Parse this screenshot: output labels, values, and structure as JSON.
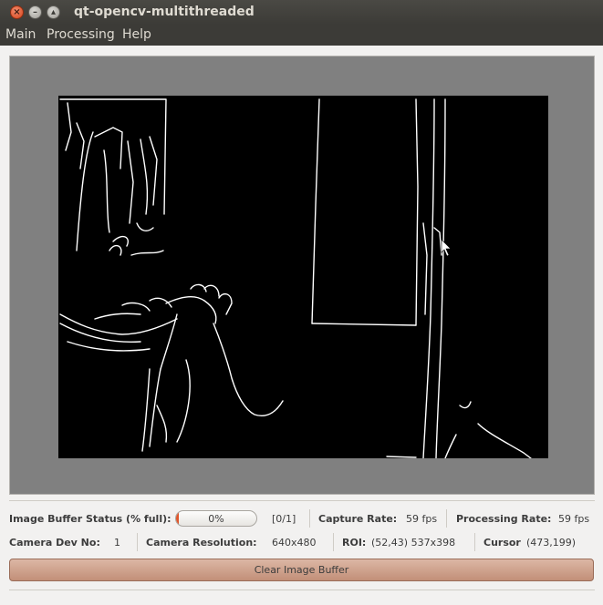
{
  "window": {
    "title": "qt-opencv-multithreaded"
  },
  "menu": {
    "items": [
      "Main",
      "Processing",
      "Help"
    ]
  },
  "status": {
    "buffer_label": "Image Buffer Status (% full):",
    "buffer_percent": 0,
    "buffer_text": "0%",
    "buffer_count": "[0/1]",
    "capture_rate_label": "Capture Rate:",
    "capture_rate_value": "59 fps",
    "processing_rate_label": "Processing Rate:",
    "processing_rate_value": "59 fps",
    "camera_dev_label": "Camera Dev No:",
    "camera_dev_value": "1",
    "camera_res_label": "Camera Resolution:",
    "camera_res_value": "640x480",
    "roi_label": "ROI:",
    "roi_value": "(52,43) 537x398",
    "cursor_label": "Cursor",
    "cursor_value": "(473,199)"
  },
  "actions": {
    "clear_buffer_label": "Clear Image Buffer"
  },
  "colors": {
    "progress_fill": "#e0562c",
    "frame_background": "#000000",
    "panel_background": "#808080"
  }
}
